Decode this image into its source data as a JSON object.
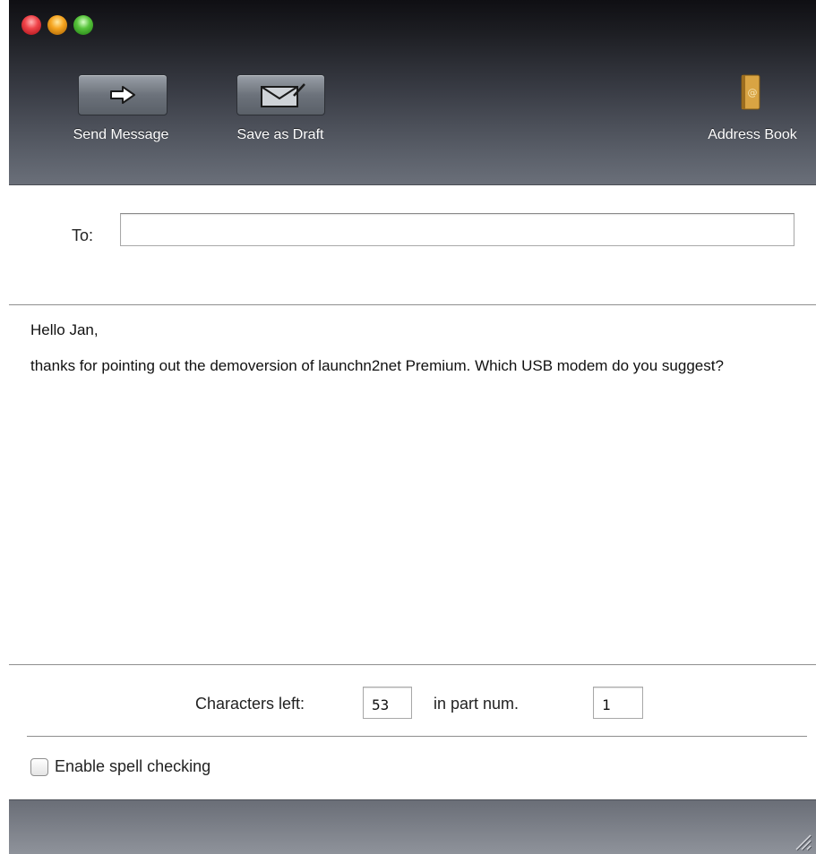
{
  "toolbar": {
    "send_label": "Send Message",
    "draft_label": "Save as Draft",
    "address_book_label": "Address Book",
    "icons": {
      "send": "arrow-right-icon",
      "draft": "envelope-icon",
      "address_book": "address-book-icon"
    }
  },
  "compose": {
    "to_label": "To:",
    "to_value": ""
  },
  "message": {
    "greeting": "Hello Jan,",
    "body": "thanks for pointing out the demoversion of launchn2net Premium. Which USB modem do you suggest?"
  },
  "counters": {
    "chars_left_label": "Characters left:",
    "chars_left_value": "53",
    "part_label": "in part num.",
    "part_value": "1"
  },
  "spell": {
    "label": "Enable spell checking",
    "checked": false
  },
  "colors": {
    "close": "#f0444a",
    "minimize": "#f6a521",
    "zoom": "#58c43c"
  }
}
